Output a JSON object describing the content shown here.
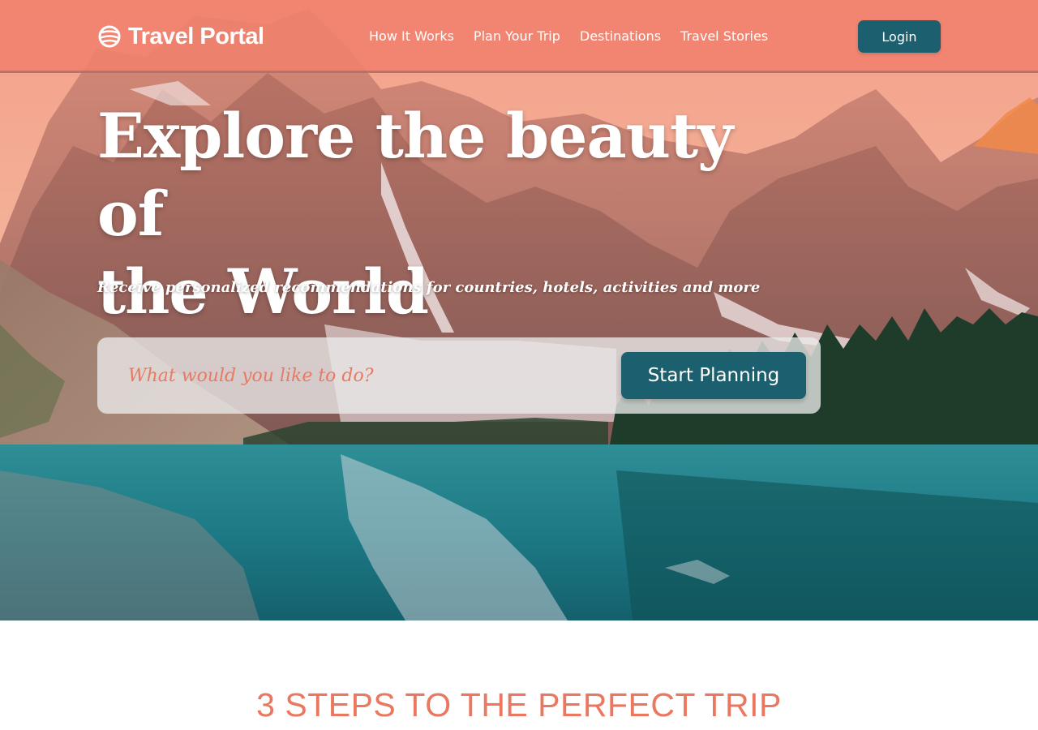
{
  "brand": {
    "name": "Travel Portal",
    "icon": "globe-icon",
    "accent": "#f0806c",
    "button_color": "#1c5f6f"
  },
  "nav": {
    "items": [
      {
        "label": "How It Works"
      },
      {
        "label": "Plan Your Trip"
      },
      {
        "label": "Destinations"
      },
      {
        "label": "Travel Stories"
      }
    ],
    "login_label": "Login"
  },
  "hero": {
    "title_line1": "Explore the beauty of",
    "title_line2": "the World",
    "subtitle": "Receive personalized recommendations for countries, hotels, activities and more",
    "background": "mountain-lake-photo"
  },
  "search": {
    "placeholder": "What would you like to do?",
    "value": "",
    "button_label": "Start Planning"
  },
  "steps": {
    "heading": "3 STEPS TO THE PERFECT TRIP"
  }
}
